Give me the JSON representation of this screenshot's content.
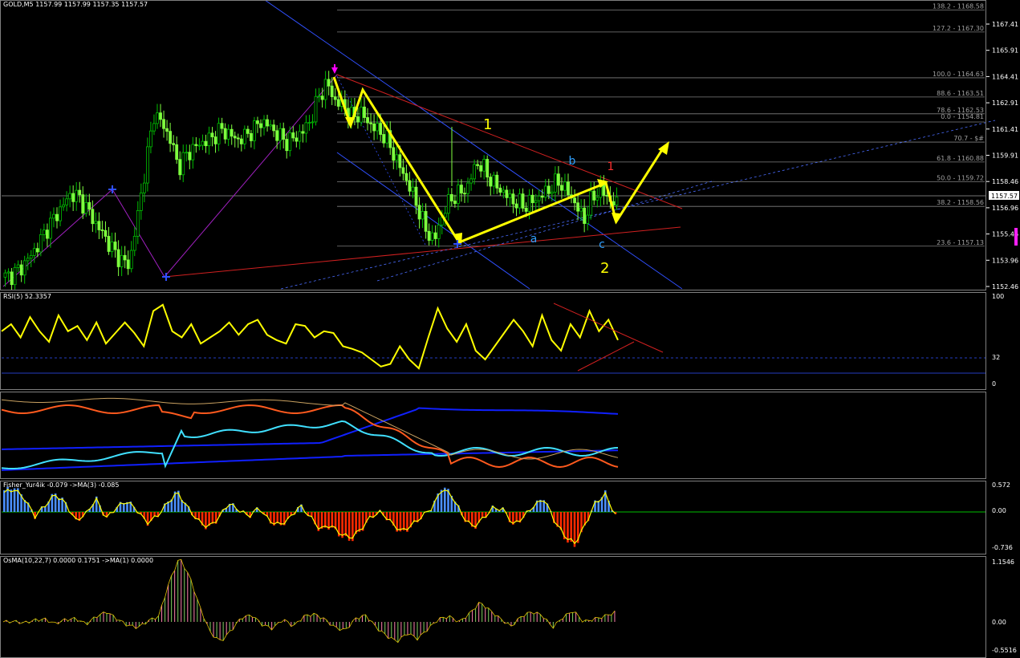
{
  "window": {
    "title": "GOLD,M5  1157.99 1157.99 1157.35 1157.57"
  },
  "colors": {
    "candle_up": "#00c000",
    "candle_body_up": "#000000",
    "candle_down": "#7fff3f",
    "yellow": "#ffff00",
    "red": "#ff0000",
    "blue": "#1e90ff",
    "fib": "#808080",
    "rsi": "#ffff00",
    "fisher_pos": "#4b8fff",
    "fisher_neg": "#ff2a00",
    "baseline": "#00ff00"
  },
  "price_pane": {
    "scale_labels": [
      "1167.41",
      "1165.91",
      "1164.41",
      "1162.91",
      "1161.41",
      "1159.91",
      "1158.46",
      "1156.96",
      "1155.46",
      "1153.96",
      "1152.46"
    ],
    "current_price": "1157.57",
    "fib_labels": [
      "138.2 - 1168.58",
      "127.2 - 1167.30",
      "100.0 - 1164.63",
      "88.6 - 1163.51",
      "78.6 - 1162.53",
      "70.7 - $#",
      "61.8 - 1160.88",
      "50.0 - 1159.72",
      "38.2 - 1158.56",
      "23.6 - 1157.13",
      "0.0 - 1154.81"
    ],
    "wave_labels": {
      "big1": "1",
      "big2": "2",
      "red1": "1",
      "a": "a",
      "b": "b",
      "c": "c"
    }
  },
  "rsi_pane": {
    "label": "RSI(5) 52.3357",
    "scale_labels": [
      "100",
      "32",
      "0"
    ]
  },
  "ma_pane": {
    "label": ""
  },
  "fisher_pane": {
    "label": "Fisher_Yur4ik -0.079  ->MA(3) -0.085",
    "scale_labels": [
      "0.572",
      "0.00",
      "-0.736"
    ]
  },
  "osma_pane": {
    "label": "OsMA(10,22,7) 0.0000 0.1751  ->MA(1) 0.0000",
    "scale_labels": [
      "1.1546",
      "0.00",
      "-0.5516"
    ]
  },
  "chart_data": {
    "type": "line",
    "title": "GOLD,M5",
    "ohlc_last": {
      "open": 1157.99,
      "high": 1157.99,
      "low": 1157.35,
      "close": 1157.57
    },
    "ylim": [
      1152.46,
      1168.58
    ],
    "fibonacci": [
      {
        "level": 138.2,
        "price": 1168.58
      },
      {
        "level": 127.2,
        "price": 1167.3
      },
      {
        "level": 100.0,
        "price": 1164.63
      },
      {
        "level": 88.6,
        "price": 1163.51
      },
      {
        "level": 78.6,
        "price": 1162.53
      },
      {
        "level": 61.8,
        "price": 1160.88
      },
      {
        "level": 50.0,
        "price": 1159.72
      },
      {
        "level": 38.2,
        "price": 1158.56
      },
      {
        "level": 23.6,
        "price": 1157.13
      },
      {
        "level": 0.0,
        "price": 1154.81
      }
    ],
    "price_path": [
      1153.0,
      1153.2,
      1153.6,
      1154.2,
      1154.9,
      1155.8,
      1156.5,
      1157.2,
      1157.9,
      1157.6,
      1156.9,
      1156.1,
      1155.4,
      1154.6,
      1154.0,
      1153.7,
      1156.5,
      1159.5,
      1162.5,
      1162.0,
      1161.0,
      1159.4,
      1160.2,
      1160.6,
      1160.9,
      1161.1,
      1161.6,
      1161.4,
      1161.0,
      1161.2,
      1161.6,
      1162.1,
      1161.8,
      1161.3,
      1160.9,
      1161.1,
      1161.5,
      1162.2,
      1163.6,
      1164.3,
      1163.2,
      1163.0,
      1162.3,
      1162.6,
      1162.0,
      1161.6,
      1161.2,
      1160.2,
      1159.2,
      1158.2,
      1157.0,
      1155.6,
      1155.2,
      1156.8,
      1157.6,
      1157.9,
      1158.3,
      1159.7,
      1159.3,
      1158.5,
      1158.1,
      1157.6,
      1157.3,
      1157.2,
      1157.5,
      1157.8,
      1158.2,
      1158.6,
      1158.0,
      1157.3,
      1156.3,
      1157.6,
      1158.1,
      1157.6,
      1157.2
    ],
    "rsi": [
      62,
      70,
      55,
      78,
      62,
      50,
      80,
      62,
      68,
      52,
      72,
      48,
      60,
      72,
      60,
      45,
      85,
      92,
      62,
      55,
      70,
      48,
      55,
      62,
      72,
      58,
      70,
      75,
      58,
      52,
      48,
      70,
      68,
      55,
      62,
      60,
      45,
      42,
      38,
      30,
      22,
      25,
      45,
      30,
      20,
      55,
      88,
      65,
      50,
      70,
      40,
      30,
      45,
      60,
      75,
      62,
      45,
      80,
      52,
      40,
      70,
      55,
      85,
      62,
      75,
      52
    ],
    "fisher": [
      0.45,
      0.52,
      0.3,
      -0.1,
      0.15,
      0.4,
      0.2,
      -0.2,
      -0.05,
      0.3,
      -0.15,
      0.1,
      0.25,
      0.05,
      -0.25,
      -0.1,
      0.2,
      0.45,
      0.1,
      -0.2,
      -0.35,
      -0.15,
      0.2,
      0.05,
      -0.1,
      0.1,
      -0.2,
      -0.3,
      -0.15,
      0.15,
      -0.1,
      -0.4,
      -0.3,
      -0.5,
      -0.6,
      -0.4,
      -0.1,
      0.0,
      -0.25,
      -0.45,
      -0.3,
      -0.1,
      0.1,
      0.55,
      0.35,
      -0.1,
      -0.35,
      -0.15,
      0.1,
      0.05,
      -0.3,
      -0.1,
      0.15,
      0.3,
      -0.2,
      -0.55,
      -0.73,
      -0.3,
      0.2,
      0.4,
      -0.08
    ],
    "osma": [
      0.0,
      0.01,
      -0.02,
      0.03,
      0.05,
      -0.03,
      0.04,
      0.06,
      -0.04,
      0.1,
      0.18,
      0.05,
      -0.06,
      -0.1,
      0.02,
      0.1,
      0.7,
      1.15,
      0.8,
      0.25,
      -0.2,
      -0.35,
      -0.15,
      0.08,
      0.12,
      -0.05,
      -0.12,
      0.05,
      -0.08,
      0.1,
      0.14,
      0.05,
      -0.1,
      -0.15,
      0.06,
      0.12,
      -0.1,
      -0.25,
      -0.35,
      -0.2,
      -0.3,
      -0.12,
      0.05,
      0.1,
      0.0,
      0.15,
      0.35,
      0.2,
      0.05,
      -0.08,
      0.1,
      0.18,
      0.12,
      -0.1,
      0.08,
      0.2,
      0.0,
      0.05,
      0.1,
      0.17
    ]
  }
}
